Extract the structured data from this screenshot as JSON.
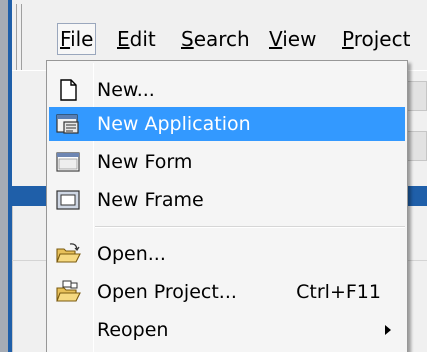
{
  "menubar": {
    "items": [
      {
        "label": "File"
      },
      {
        "label": "Edit"
      },
      {
        "label": "Search"
      },
      {
        "label": "View"
      },
      {
        "label": "Project"
      }
    ],
    "active": "File"
  },
  "file_menu": {
    "items": [
      {
        "label": "New...",
        "icon": "new-document-icon"
      },
      {
        "label": "New Application",
        "icon": "new-application-icon",
        "highlighted": true
      },
      {
        "label": "New Form",
        "icon": "new-form-icon"
      },
      {
        "label": "New Frame",
        "icon": "new-frame-icon"
      },
      {
        "label": "Open...",
        "icon": "open-folder-icon"
      },
      {
        "label": "Open Project...",
        "icon": "open-project-icon",
        "shortcut": "Ctrl+F11"
      },
      {
        "label": "Reopen",
        "submenu": true
      }
    ]
  },
  "colors": {
    "highlight": "#3399ff",
    "menu_background": "#f5f5f5",
    "window_blue": "#1f5fa9"
  }
}
